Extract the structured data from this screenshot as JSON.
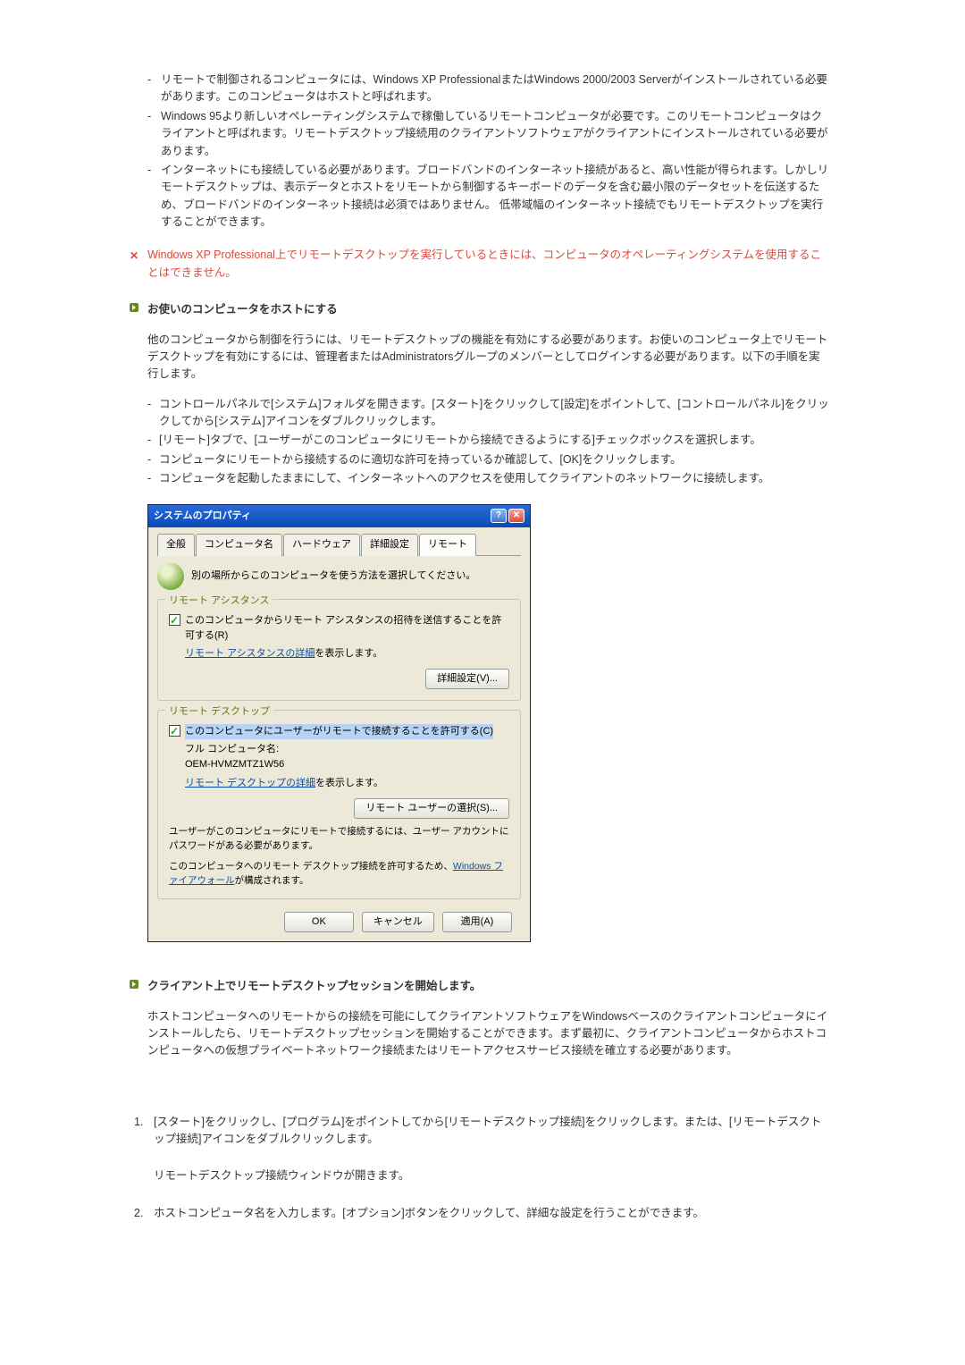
{
  "requirements": [
    "リモートで制御されるコンピュータには、Windows XP ProfessionalまたはWindows 2000/2003 Serverがインストールされている必要があります。このコンピュータはホストと呼ばれます。",
    "Windows 95より新しいオペレーティングシステムで稼働しているリモートコンピュータが必要です。このリモートコンピュータはクライアントと呼ばれます。リモートデスクトップ接続用のクライアントソフトウェアがクライアントにインストールされている必要があります。",
    "インターネットにも接続している必要があります。ブロードバンドのインターネット接続があると、高い性能が得られます。しかしリモートデスクトップは、表示データとホストをリモートから制御するキーボードのデータを含む最小限のデータセットを伝送するため、ブロードバンドのインターネット接続は必須ではありません。 低帯域幅のインターネット接続でもリモートデスクトップを実行することができます。"
  ],
  "note": {
    "icon": "✕",
    "text": "Windows XP Professional上でリモートデスクトップを実行しているときには、コンピュータのオペレーティングシステムを使用することはできません。"
  },
  "section1": {
    "title": "お使いのコンピュータをホストにする",
    "intro": "他のコンピュータから制御を行うには、リモートデスクトップの機能を有効にする必要があります。お使いのコンピュータ上でリモートデスクトップを有効にするには、管理者またはAdministratorsグループのメンバーとしてログインする必要があります。以下の手順を実行します。",
    "steps": [
      "コントロールパネルで[システム]フォルダを開きます。[スタート]をクリックして[設定]をポイントして、[コントロールパネル]をクリックしてから[システム]アイコンをダブルクリックします。",
      "[リモート]タブで、[ユーザーがこのコンピュータにリモートから接続できるようにする]チェックボックスを選択します。",
      "コンピュータにリモートから接続するのに適切な許可を持っているか確認して、[OK]をクリックします。",
      "コンピュータを起動したままにして、インターネットへのアクセスを使用してクライアントのネットワークに接続します。"
    ]
  },
  "dialog": {
    "title": "システムのプロパティ",
    "help": "?",
    "close": "✕",
    "tabs": [
      "全般",
      "コンピュータ名",
      "ハードウェア",
      "詳細設定",
      "リモート"
    ],
    "active_tab": 4,
    "instruction": "別の場所からこのコンピュータを使う方法を選択してください。",
    "ra": {
      "legend": "リモート アシスタンス",
      "cb_label": "このコンピュータからリモート アシスタンスの招待を送信することを許可する(R)",
      "detail_link": "リモート アシスタンスの詳細",
      "detail_suffix": "を表示します。",
      "btn": "詳細設定(V)..."
    },
    "rd": {
      "legend": "リモート デスクトップ",
      "cb_label": "このコンピュータにユーザーがリモートで接続することを許可する(C)",
      "name_label": "フル コンピュータ名:",
      "name_value": "OEM-HVMZMTZ1W56",
      "detail_link": "リモート デスクトップの詳細",
      "detail_suffix": "を表示します。",
      "btn": "リモート ユーザーの選択(S)...",
      "note1": "ユーザーがこのコンピュータにリモートで接続するには、ユーザー アカウントにパスワードがある必要があります。",
      "note2_prefix": "このコンピュータへのリモート デスクトップ接続を許可するため、",
      "note2_link": "Windows ファイアウォール",
      "note2_suffix": "が構成されます。"
    },
    "footer": {
      "ok": "OK",
      "cancel": "キャンセル",
      "apply": "適用(A)"
    }
  },
  "section2": {
    "title": "クライアント上でリモートデスクトップセッションを開始します。",
    "intro": "ホストコンピュータへのリモートからの接続を可能にしてクライアントソフトウェアをWindowsベースのクライアントコンピュータにインストールしたら、リモートデスクトップセッションを開始することができます。まず最初に、クライアントコンピュータからホストコンピュータへの仮想プライベートネットワーク接続またはリモートアクセスサービス接続を確立する必要があります。",
    "steps": [
      {
        "text": "[スタート]をクリックし、[プログラム]をポイントしてから[リモートデスクトップ接続]をクリックします。または、[リモートデスクトップ接続]アイコンをダブルクリックします。",
        "extra": "リモートデスクトップ接続ウィンドウが開きます。"
      },
      {
        "text": "ホストコンピュータ名を入力します。[オプション]ボタンをクリックして、詳細な設定を行うことができます。"
      }
    ]
  }
}
